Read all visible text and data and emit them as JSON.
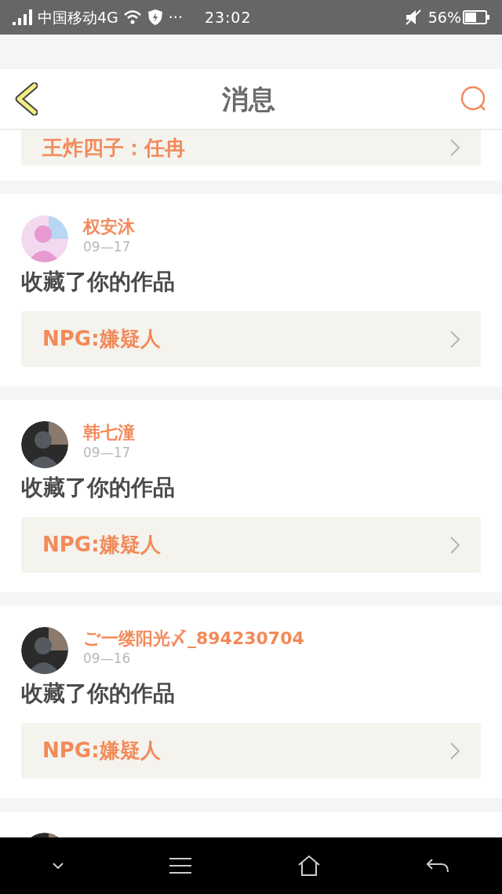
{
  "status_bar": {
    "carrier": "中国移动4G",
    "dots": "···",
    "time": "23:02",
    "battery": "56%"
  },
  "header": {
    "title": "消息"
  },
  "partial_top": {
    "link": "王炸四子：任冉"
  },
  "messages": [
    {
      "name": "权安沐",
      "date": "09—17",
      "action": "收藏了你的作品",
      "link": "NPG:嫌疑人"
    },
    {
      "name": "韩七潼",
      "date": "09—17",
      "action": "收藏了你的作品",
      "link": "NPG:嫌疑人"
    },
    {
      "name": "ご一缕阳光〆_894230704",
      "date": "09—16",
      "action": "收藏了你的作品",
      "link": "NPG:嫌疑人"
    }
  ]
}
